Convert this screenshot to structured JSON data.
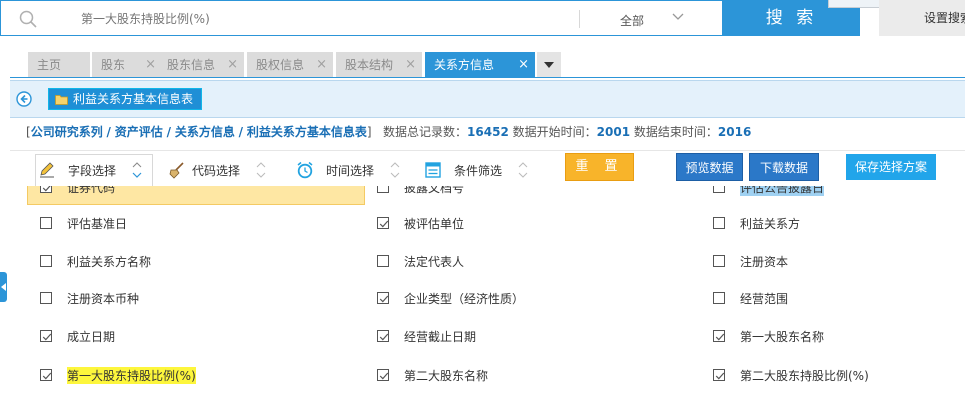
{
  "search": {
    "placeholder": "第一大股东持股比例(%)",
    "scope": "全部",
    "button": "搜 索",
    "settings": "设置搜索"
  },
  "tabs": [
    {
      "label": "主页",
      "closable": false
    },
    {
      "label": "股东",
      "closable": true
    },
    {
      "label": "股东信息",
      "closable": true
    },
    {
      "label": "股权信息",
      "closable": true
    },
    {
      "label": "股本结构",
      "closable": true
    },
    {
      "label": "关系方信息",
      "closable": true,
      "active": true
    }
  ],
  "info_bar": {
    "title": "利益关系方基本信息表"
  },
  "breadcrumb": {
    "open": "[",
    "items": [
      "公司研究系列",
      "资产评估",
      "关系方信息",
      "利益关系方基本信息表"
    ],
    "sep": "/",
    "close": "]",
    "total_label": "数据总记录数：",
    "total": "16452",
    "start_label": "数据开始时间：",
    "start": "2001",
    "end_label": "数据结束时间：",
    "end": "2016"
  },
  "toolbar": {
    "field_select": "字段选择",
    "code_select": "代码选择",
    "time_select": "时间选择",
    "condition_filter": "条件筛选",
    "reset": "重 置",
    "preview": "预览数据",
    "download": "下载数据",
    "save_scheme": "保存选择方案"
  },
  "fields": [
    [
      {
        "label": "证券代码",
        "checked": true,
        "highlight": "selected"
      },
      {
        "label": "披露文档号",
        "checked": false
      },
      {
        "label": "评估公告披露日",
        "checked": false,
        "highlight": "blue"
      }
    ],
    [
      {
        "label": "评估基准日",
        "checked": false
      },
      {
        "label": "被评估单位",
        "checked": true
      },
      {
        "label": "利益关系方",
        "checked": false
      }
    ],
    [
      {
        "label": "利益关系方名称",
        "checked": false
      },
      {
        "label": "法定代表人",
        "checked": false
      },
      {
        "label": "注册资本",
        "checked": false
      }
    ],
    [
      {
        "label": "注册资本币种",
        "checked": false
      },
      {
        "label": "企业类型（经济性质）",
        "checked": true
      },
      {
        "label": "经营范围",
        "checked": false
      }
    ],
    [
      {
        "label": "成立日期",
        "checked": true
      },
      {
        "label": "经营截止日期",
        "checked": true
      },
      {
        "label": "第一大股东名称",
        "checked": true
      }
    ],
    [
      {
        "label": "第一大股东持股比例(%)",
        "checked": true,
        "highlight": "yellow"
      },
      {
        "label": "第二大股东名称",
        "checked": true
      },
      {
        "label": "第二大股东持股比例(%)",
        "checked": true
      }
    ]
  ],
  "colors": {
    "accent": "#2c95d8",
    "reset": "#f8b42a",
    "dark_button": "#2b78c8",
    "save": "#21a5ea"
  }
}
